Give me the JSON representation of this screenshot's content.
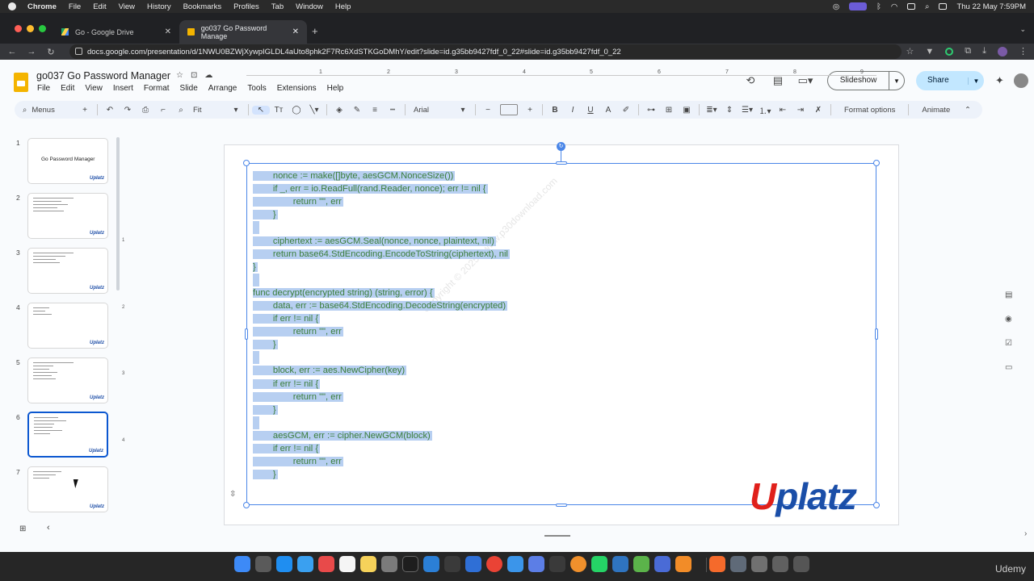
{
  "mac_menubar": {
    "app": "Chrome",
    "items": [
      "File",
      "Edit",
      "View",
      "History",
      "Bookmarks",
      "Profiles",
      "Tab",
      "Window",
      "Help"
    ],
    "datetime": "Thu 22 May  7:59PM"
  },
  "browser": {
    "tabs": [
      {
        "title": "Go - Google Drive"
      },
      {
        "title": "go037 Go Password Manage"
      }
    ],
    "url": "docs.google.com/presentation/d/1NWU0BZWjXywpIGLDL4aUto8phk2F7Rc6XdSTKGoDMhY/edit?slide=id.g35bb9427fdf_0_22#slide=id.g35bb9427fdf_0_22"
  },
  "slides_app": {
    "doc_title": "go037 Go Password Manager",
    "menu": [
      "File",
      "Edit",
      "View",
      "Insert",
      "Format",
      "Slide",
      "Arrange",
      "Tools",
      "Extensions",
      "Help"
    ],
    "slideshow_label": "Slideshow",
    "share_label": "Share",
    "toolbar": {
      "search_label": "Menus",
      "zoom": "Fit",
      "font": "Arial",
      "format_options": "Format options",
      "animate": "Animate"
    },
    "ruler_ticks": [
      "1",
      "2",
      "3",
      "4",
      "5",
      "6",
      "7",
      "8",
      "9"
    ],
    "vruler_ticks": [
      "1",
      "2",
      "3",
      "4",
      "5"
    ]
  },
  "filmstrip": {
    "slides": [
      {
        "num": "1",
        "title": "Go Password Manager"
      },
      {
        "num": "2",
        "title": ""
      },
      {
        "num": "3",
        "title": ""
      },
      {
        "num": "4",
        "title": ""
      },
      {
        "num": "5",
        "title": ""
      },
      {
        "num": "6",
        "title": ""
      },
      {
        "num": "7",
        "title": ""
      }
    ],
    "logo": "Uplatz"
  },
  "slide_content": {
    "code_lines": [
      "        nonce := make([]byte, aesGCM.NonceSize())",
      "        if _, err = io.ReadFull(rand.Reader, nonce); err != nil {",
      "                return \"\", err",
      "        }",
      "",
      "        ciphertext := aesGCM.Seal(nonce, nonce, plaintext, nil)",
      "        return base64.StdEncoding.EncodeToString(ciphertext), nil",
      "}",
      "",
      "func decrypt(encrypted string) (string, error) {",
      "        data, err := base64.StdEncoding.DecodeString(encrypted)",
      "        if err != nil {",
      "                return \"\", err",
      "        }",
      "",
      "        block, err := aes.NewCipher(key)",
      "        if err != nil {",
      "                return \"\", err",
      "        }",
      "",
      "        aesGCM, err := cipher.NewGCM(block)",
      "        if err != nil {",
      "                return \"\", err",
      "        }"
    ],
    "watermark": "Copyright © 2025 - www.p30download.com",
    "logo_first": "U",
    "logo_rest": "platz"
  },
  "dock": {
    "watermark": "Udemy"
  }
}
